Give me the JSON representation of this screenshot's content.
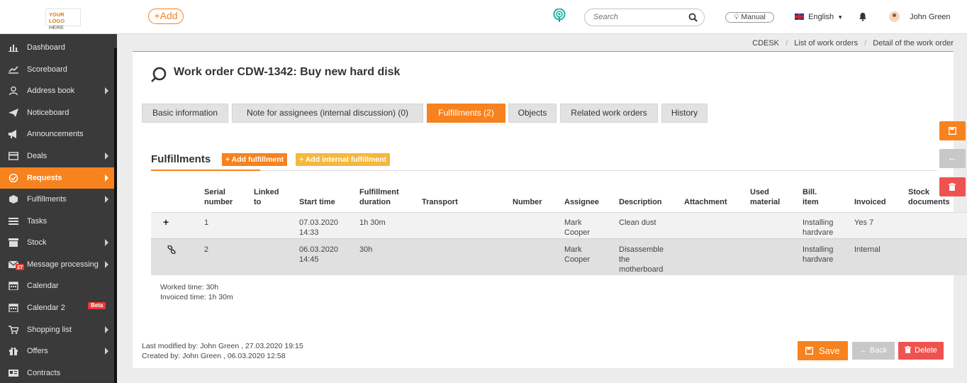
{
  "header": {
    "logo_line1": "YOUR LOGO",
    "logo_line2": "HERE",
    "add_label": "+Add",
    "search_placeholder": "Search",
    "manual_label": "Manual",
    "language": "English",
    "user_name": "John Green"
  },
  "sidebar": {
    "items": [
      {
        "label": "Dashboard",
        "icon": "bar-chart-icon",
        "arrow": false
      },
      {
        "label": "Scoreboard",
        "icon": "line-chart-icon",
        "arrow": false
      },
      {
        "label": "Address book",
        "icon": "user-icon",
        "arrow": true
      },
      {
        "label": "Noticeboard",
        "icon": "paper-plane-icon",
        "arrow": false
      },
      {
        "label": "Announcements",
        "icon": "megaphone-icon",
        "arrow": false
      },
      {
        "label": "Deals",
        "icon": "card-icon",
        "arrow": true
      },
      {
        "label": "Requests",
        "icon": "check-circle-icon",
        "arrow": true,
        "active": true
      },
      {
        "label": "Fulfillments",
        "icon": "cube-icon",
        "arrow": true
      },
      {
        "label": "Tasks",
        "icon": "list-icon",
        "arrow": false
      },
      {
        "label": "Stock",
        "icon": "box-icon",
        "arrow": true
      },
      {
        "label": "Message processing",
        "icon": "envelope-icon",
        "arrow": true,
        "badge": "27"
      },
      {
        "label": "Calendar",
        "icon": "calendar-icon",
        "arrow": false
      },
      {
        "label": "Calendar 2",
        "icon": "calendar-icon",
        "arrow": false,
        "badge": "Beta"
      },
      {
        "label": "Shopping list",
        "icon": "cart-icon",
        "arrow": true
      },
      {
        "label": "Offers",
        "icon": "gift-icon",
        "arrow": true
      },
      {
        "label": "Contracts",
        "icon": "document-icon",
        "arrow": false
      }
    ]
  },
  "breadcrumb": [
    "CDESK",
    "List of work orders",
    "Detail of the work order"
  ],
  "page": {
    "title": "Work order CDW-1342: Buy new hard disk"
  },
  "tabs": [
    {
      "label": "Basic information"
    },
    {
      "label": "Note for assignees (internal discussion) (0)"
    },
    {
      "label": "Fulfillments (2)",
      "active": true
    },
    {
      "label": "Objects"
    },
    {
      "label": "Related work orders"
    },
    {
      "label": "History"
    }
  ],
  "fulfillments": {
    "title": "Fulfillments",
    "add_label": "Add fulfillment",
    "add_internal_label": "Add internal fulfillment",
    "columns": {
      "serial_1": "Serial",
      "serial_2": "number",
      "linked_1": "Linked",
      "linked_2": "to",
      "start": "Start time",
      "duration_1": "Fulfillment",
      "duration_2": "duration",
      "transport": "Transport",
      "number": "Number",
      "assignee": "Assignee",
      "description": "Description",
      "attachment": "Attachment",
      "used_1": "Used",
      "used_2": "material",
      "bill_1": "Bill.",
      "bill_2": "item",
      "invoiced": "Invoiced",
      "stock_1": "Stock",
      "stock_2": "documents"
    },
    "rows": [
      {
        "serial": "1",
        "start_date": "07.03.2020",
        "start_time": "14:33",
        "duration": "1h 30m",
        "assignee_1": "Mark",
        "assignee_2": "Cooper",
        "description_1": "Clean dust",
        "description_2": "",
        "description_3": "",
        "bill_1": "Installing",
        "bill_2": "hardvare",
        "invoiced": "Yes 7"
      },
      {
        "serial": "2",
        "start_date": "06.03.2020",
        "start_time": "14:45",
        "duration": "30h",
        "assignee_1": "Mark",
        "assignee_2": "Cooper",
        "description_1": "Disassemble",
        "description_2": "the",
        "description_3": "motherboard",
        "bill_1": "Installing",
        "bill_2": "hardvare",
        "invoiced": "Internal"
      }
    ],
    "worked_time": "Worked time: 30h",
    "invoiced_time": "Invoiced time: 1h 30m"
  },
  "footer": {
    "last_modified": "Last modified by:  John Green , 27.03.2020 19:15",
    "created": "Created by:  John Green , 06.03.2020 12:58"
  },
  "actions": {
    "save": "Save",
    "back": "Back",
    "delete": "Delete"
  },
  "colors": {
    "accent": "#f7821e",
    "sidebar_bg": "#3a3a3a",
    "danger": "#ef5350",
    "add_internal": "#f5b83d"
  }
}
